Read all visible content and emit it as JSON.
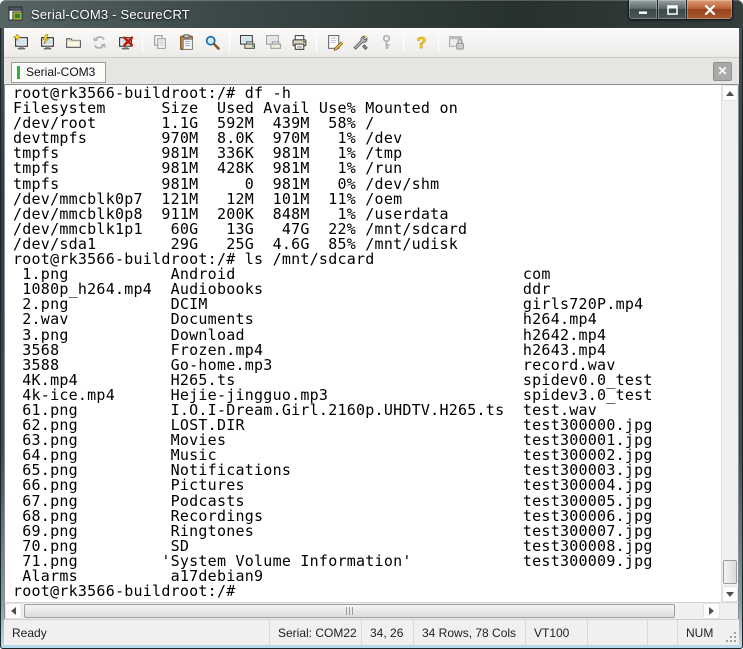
{
  "window": {
    "title": "Serial-COM3 - SecureCRT"
  },
  "toolbar": {
    "items": [
      {
        "name": "quick-connect",
        "disabled": false
      },
      {
        "name": "connect",
        "disabled": false
      },
      {
        "name": "connect-in-tab",
        "disabled": false
      },
      {
        "name": "reconnect",
        "disabled": true
      },
      {
        "name": "disconnect",
        "disabled": false
      },
      {
        "sep": true
      },
      {
        "name": "copy",
        "disabled": true
      },
      {
        "name": "paste",
        "disabled": false
      },
      {
        "name": "find",
        "disabled": false
      },
      {
        "sep": true
      },
      {
        "name": "print-screen",
        "disabled": false
      },
      {
        "name": "print-selection",
        "disabled": true
      },
      {
        "name": "print",
        "disabled": false
      },
      {
        "sep": true
      },
      {
        "name": "session-options",
        "disabled": false
      },
      {
        "name": "global-options",
        "disabled": false
      },
      {
        "name": "keymap",
        "disabled": true
      },
      {
        "sep": true
      },
      {
        "name": "help",
        "disabled": false
      },
      {
        "sep": true
      },
      {
        "name": "session-lock",
        "disabled": true
      }
    ]
  },
  "tabbar": {
    "tab_label": "Serial-COM3",
    "close_glyph": "✕"
  },
  "terminal": {
    "prompt": "root@rk3566-buildroot:/#",
    "df_command": "df -h",
    "ls_command": "ls /mnt/sdcard",
    "df_table": {
      "header": [
        "Filesystem",
        "Size",
        "Used",
        "Avail",
        "Use%",
        "Mounted on"
      ],
      "rows": [
        [
          "/dev/root",
          "1.1G",
          "592M",
          "439M",
          "58%",
          "/"
        ],
        [
          "devtmpfs",
          "970M",
          "8.0K",
          "970M",
          "1%",
          "/dev"
        ],
        [
          "tmpfs",
          "981M",
          "336K",
          "981M",
          "1%",
          "/tmp"
        ],
        [
          "tmpfs",
          "981M",
          "428K",
          "981M",
          "1%",
          "/run"
        ],
        [
          "tmpfs",
          "981M",
          "0",
          "981M",
          "0%",
          "/dev/shm"
        ],
        [
          "/dev/mmcblk0p7",
          "121M",
          "12M",
          "101M",
          "11%",
          "/oem"
        ],
        [
          "/dev/mmcblk0p8",
          "911M",
          "200K",
          "848M",
          "1%",
          "/userdata"
        ],
        [
          "/dev/mmcblk1p1",
          "60G",
          "13G",
          "47G",
          "22%",
          "/mnt/sdcard"
        ],
        [
          "/dev/sda1",
          "29G",
          "25G",
          "4.6G",
          "85%",
          "/mnt/udisk"
        ]
      ]
    },
    "ls_table": {
      "rows": [
        [
          "1.png",
          "Android",
          "com"
        ],
        [
          "1080p_h264.mp4",
          "Audiobooks",
          "ddr"
        ],
        [
          "2.png",
          "DCIM",
          "girls720P.mp4"
        ],
        [
          "2.wav",
          "Documents",
          "h264.mp4"
        ],
        [
          "3.png",
          "Download",
          "h2642.mp4"
        ],
        [
          "3568",
          "Frozen.mp4",
          "h2643.mp4"
        ],
        [
          "3588",
          "Go-home.mp3",
          "record.wav"
        ],
        [
          "4K.mp4",
          "H265.ts",
          "spidev0.0_test"
        ],
        [
          "4k-ice.mp4",
          "Hejie-jingguo.mp3",
          "spidev3.0_test"
        ],
        [
          "61.png",
          "I.O.I-Dream.Girl.2160p.UHDTV.H265.ts",
          "test.wav"
        ],
        [
          "62.png",
          "LOST.DIR",
          "test300000.jpg"
        ],
        [
          "63.png",
          "Movies",
          "test300001.jpg"
        ],
        [
          "64.png",
          "Music",
          "test300002.jpg"
        ],
        [
          "65.png",
          "Notifications",
          "test300003.jpg"
        ],
        [
          "66.png",
          "Pictures",
          "test300004.jpg"
        ],
        [
          "67.png",
          "Podcasts",
          "test300005.jpg"
        ],
        [
          "68.png",
          "Recordings",
          "test300006.jpg"
        ],
        [
          "69.png",
          "Ringtones",
          "test300007.jpg"
        ],
        [
          "70.png",
          "SD",
          "test300008.jpg"
        ],
        [
          "71.png",
          "'System Volume Information'",
          "test300009.jpg"
        ],
        [
          "Alarms",
          "a17debian9",
          ""
        ]
      ]
    }
  },
  "statusbar": {
    "ready": "Ready",
    "serial": "Serial: COM22",
    "cursor_position": "34, 26",
    "terminal_size": "34 Rows, 78 Cols",
    "emulation": "VT100",
    "keyboard_indicator": "NUM"
  },
  "colors": {
    "titlebar": "#33403f",
    "close_button": "#b2552e",
    "tab_indicator": "#2eb42e",
    "terminal_bg": "#ffffff",
    "terminal_fg": "#000000",
    "chrome_bg": "#f0efec"
  }
}
